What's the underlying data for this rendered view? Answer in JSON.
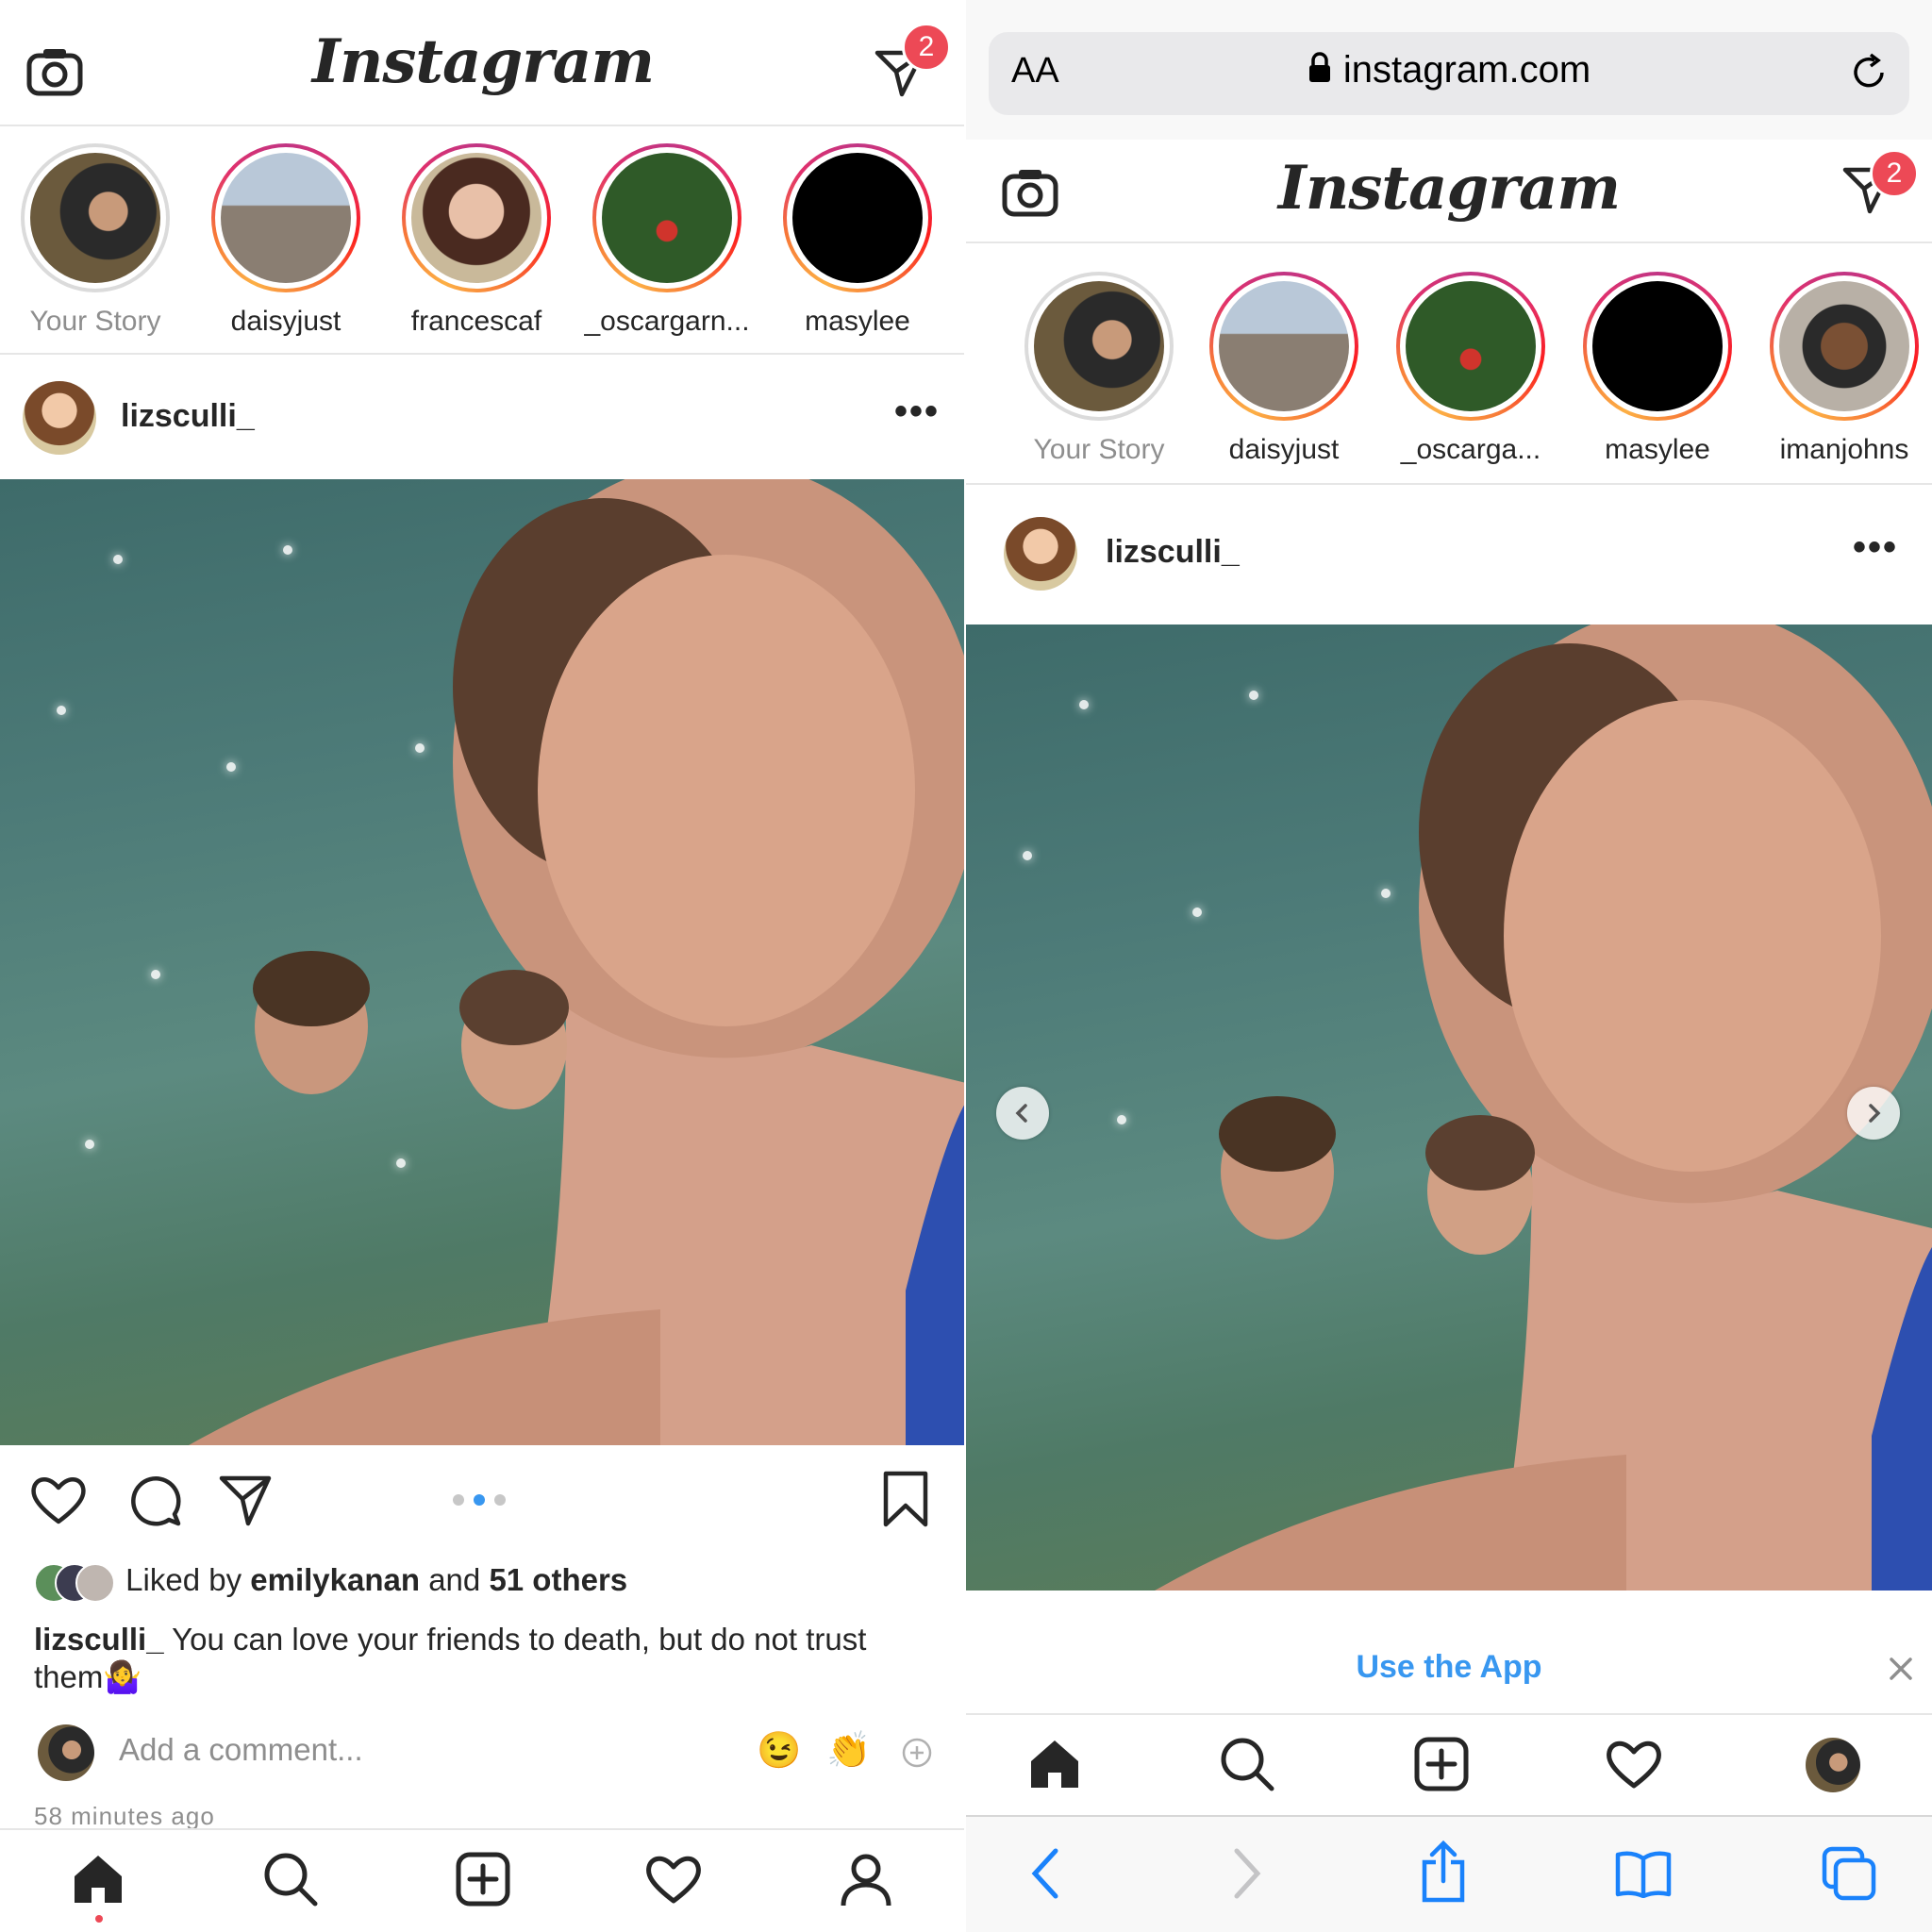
{
  "left": {
    "header": {
      "logo": "Instagram",
      "dm_badge": "2"
    },
    "stories": [
      {
        "label": "Your Story",
        "seen": true
      },
      {
        "label": "daisyjust",
        "seen": false
      },
      {
        "label": "francescaf",
        "seen": false
      },
      {
        "label": "_oscargarn...",
        "seen": false
      },
      {
        "label": "masylee",
        "seen": false
      }
    ],
    "post": {
      "username": "lizsculli_",
      "liked_prefix": "Liked by ",
      "liked_user": "emilykanan",
      "liked_and": " and ",
      "liked_others": "51 others",
      "caption_user": "lizsculli_",
      "caption_text": " You can love your friends to death, but do not trust them",
      "caption_emoji": "🤷‍♀️",
      "comment_placeholder": "Add a comment...",
      "emoji_1": "😉",
      "emoji_2": "👏",
      "timestamp": "58 minutes ago",
      "carousel_current": 2,
      "carousel_total": 3
    }
  },
  "right": {
    "urlbar": {
      "text_size_label": "AA",
      "url": "instagram.com"
    },
    "header": {
      "logo": "Instagram",
      "dm_badge": "2"
    },
    "stories": [
      {
        "label": "Your Story",
        "seen": true
      },
      {
        "label": "daisyjust",
        "seen": false
      },
      {
        "label": "_oscarga...",
        "seen": false
      },
      {
        "label": "masylee",
        "seen": false
      },
      {
        "label": "imanjohns",
        "seen": false
      }
    ],
    "post": {
      "username": "lizsculli_"
    },
    "banner": {
      "label": "Use the App"
    }
  },
  "colors": {
    "badge": "#ed4956",
    "link_blue": "#3897f0",
    "safari_blue": "#1a82fb"
  },
  "icons": [
    "camera-icon",
    "direct-icon",
    "more-icon",
    "heart-icon",
    "comment-icon",
    "share-icon",
    "bookmark-icon",
    "home-icon",
    "search-icon",
    "add-icon",
    "activity-icon",
    "profile-icon",
    "lock-icon",
    "reload-icon",
    "back-icon",
    "forward-icon",
    "safari-share-icon",
    "bookmarks-icon",
    "tabs-icon",
    "close-icon"
  ]
}
